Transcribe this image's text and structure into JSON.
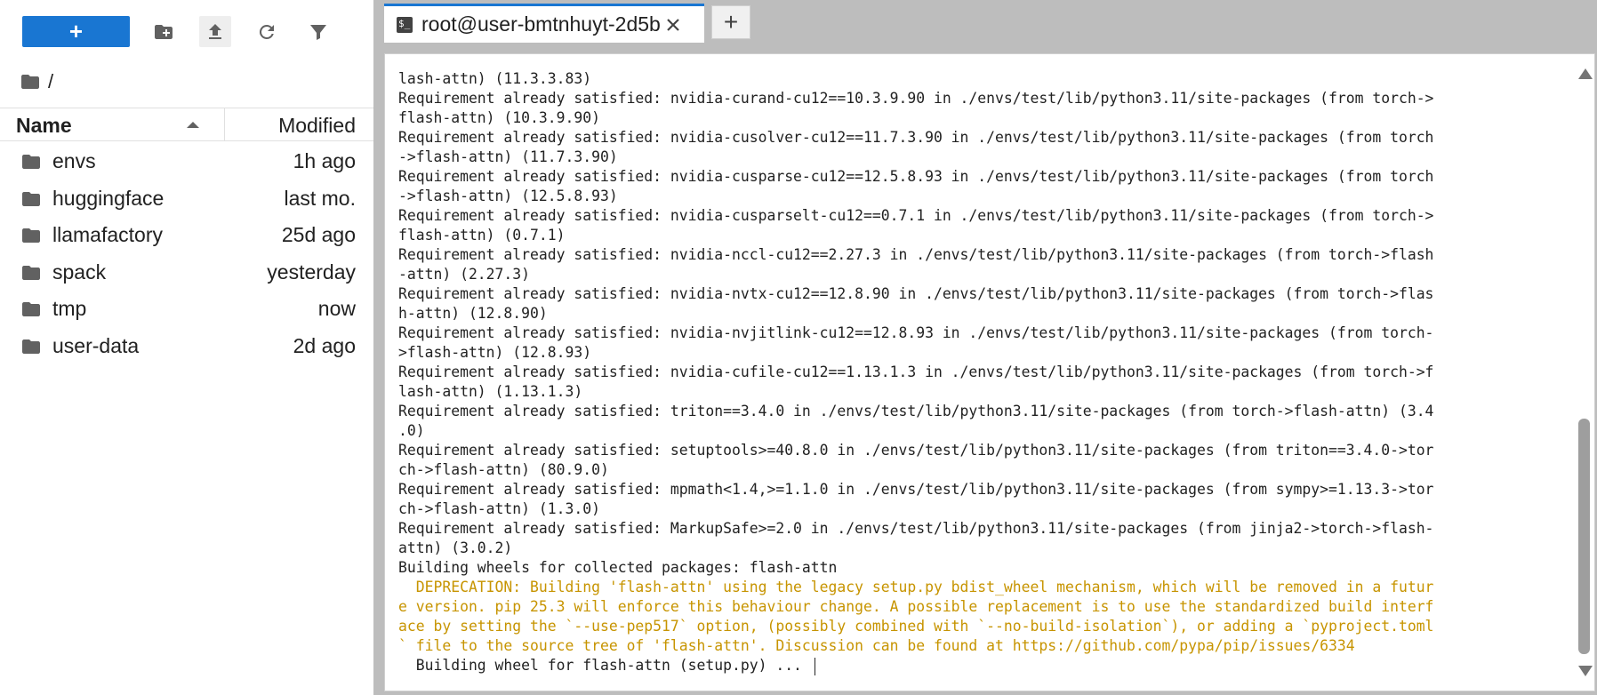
{
  "toolbar": {
    "new_label": "+",
    "buttons": [
      "new-folder-icon",
      "upload-icon",
      "refresh-icon",
      "filter-icon"
    ]
  },
  "breadcrumb": {
    "path": "/"
  },
  "file_list": {
    "columns": {
      "name": "Name",
      "modified": "Modified"
    },
    "items": [
      {
        "name": "envs",
        "modified": "1h ago"
      },
      {
        "name": "huggingface",
        "modified": "last mo."
      },
      {
        "name": "llamafactory",
        "modified": "25d ago"
      },
      {
        "name": "spack",
        "modified": "yesterday"
      },
      {
        "name": "tmp",
        "modified": "now"
      },
      {
        "name": "user-data",
        "modified": "2d ago"
      }
    ]
  },
  "terminal_tab": {
    "title": "root@user-bmtnhuyt-2d5b",
    "add_label": "+"
  },
  "terminal": {
    "lines": [
      "lash-attn) (11.3.3.83)",
      "Requirement already satisfied: nvidia-curand-cu12==10.3.9.90 in ./envs/test/lib/python3.11/site-packages (from torch->",
      "flash-attn) (10.3.9.90)",
      "Requirement already satisfied: nvidia-cusolver-cu12==11.7.3.90 in ./envs/test/lib/python3.11/site-packages (from torch",
      "->flash-attn) (11.7.3.90)",
      "Requirement already satisfied: nvidia-cusparse-cu12==12.5.8.93 in ./envs/test/lib/python3.11/site-packages (from torch",
      "->flash-attn) (12.5.8.93)",
      "Requirement already satisfied: nvidia-cusparselt-cu12==0.7.1 in ./envs/test/lib/python3.11/site-packages (from torch->",
      "flash-attn) (0.7.1)",
      "Requirement already satisfied: nvidia-nccl-cu12==2.27.3 in ./envs/test/lib/python3.11/site-packages (from torch->flash",
      "-attn) (2.27.3)",
      "Requirement already satisfied: nvidia-nvtx-cu12==12.8.90 in ./envs/test/lib/python3.11/site-packages (from torch->flas",
      "h-attn) (12.8.90)",
      "Requirement already satisfied: nvidia-nvjitlink-cu12==12.8.93 in ./envs/test/lib/python3.11/site-packages (from torch-",
      ">flash-attn) (12.8.93)",
      "Requirement already satisfied: nvidia-cufile-cu12==1.13.1.3 in ./envs/test/lib/python3.11/site-packages (from torch->f",
      "lash-attn) (1.13.1.3)",
      "Requirement already satisfied: triton==3.4.0 in ./envs/test/lib/python3.11/site-packages (from torch->flash-attn) (3.4",
      ".0)",
      "Requirement already satisfied: setuptools>=40.8.0 in ./envs/test/lib/python3.11/site-packages (from triton==3.4.0->tor",
      "ch->flash-attn) (80.9.0)",
      "Requirement already satisfied: mpmath<1.4,>=1.1.0 in ./envs/test/lib/python3.11/site-packages (from sympy>=1.13.3->tor",
      "ch->flash-attn) (1.3.0)",
      "Requirement already satisfied: MarkupSafe>=2.0 in ./envs/test/lib/python3.11/site-packages (from jinja2->torch->flash-",
      "attn) (3.0.2)",
      "Building wheels for collected packages: flash-attn"
    ],
    "warning_lines": [
      "  DEPRECATION: Building 'flash-attn' using the legacy setup.py bdist_wheel mechanism, which will be removed in a futur",
      "e version. pip 25.3 will enforce this behaviour change. A possible replacement is to use the standardized build interf",
      "ace by setting the `--use-pep517` option, (possibly combined with `--no-build-isolation`), or adding a `pyproject.toml",
      "` file to the source tree of 'flash-attn'. Discussion can be found at https://github.com/pypa/pip/issues/6334"
    ],
    "last_line": "  Building wheel for flash-attn (setup.py) ... ",
    "warning_color": "#c79400"
  },
  "colors": {
    "accent": "#1976d2",
    "panel_bg": "#bdbdbd"
  }
}
